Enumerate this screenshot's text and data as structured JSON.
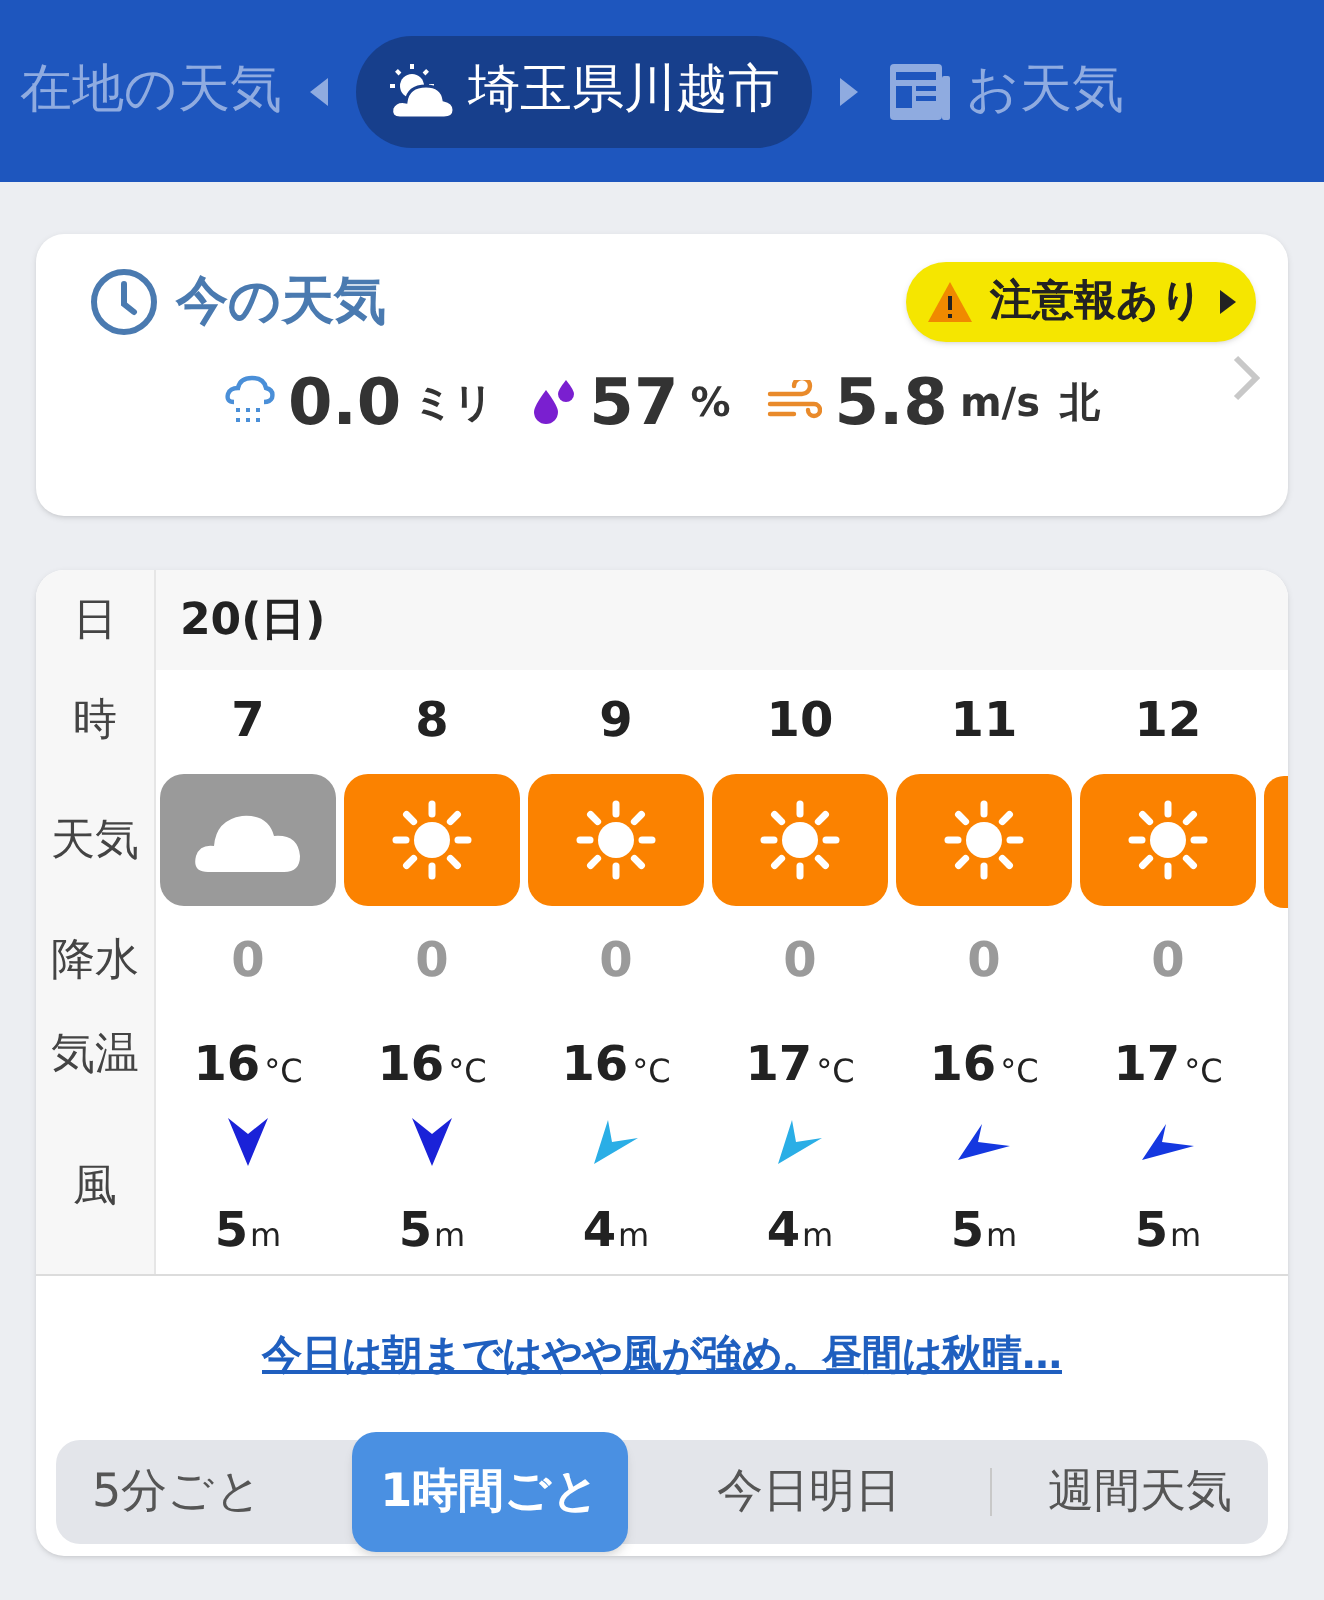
{
  "header": {
    "tabs": [
      {
        "label": "在地の天気",
        "kind": "plain",
        "selected": false
      },
      {
        "label": "埼玉県川越市",
        "kind": "location",
        "selected": true
      },
      {
        "label": "お天気",
        "kind": "news",
        "selected": false
      }
    ]
  },
  "current": {
    "title": "今の天気",
    "alert": "注意報あり",
    "stats": [
      {
        "kind": "rain",
        "value": "0.0",
        "unit": "ミリ"
      },
      {
        "kind": "humidity",
        "value": "57",
        "unit": "%"
      },
      {
        "kind": "wind",
        "value": "5.8",
        "unit": "m/s",
        "direction": "北"
      }
    ]
  },
  "forecast": {
    "row_labels": {
      "date": "日",
      "hour": "時",
      "weather": "天気",
      "precip": "降水",
      "temp": "気温",
      "wind": "風"
    },
    "date": "20(日)",
    "hours": [
      {
        "hour": "7",
        "weather": {
          "kind": "cloudy"
        },
        "precip": "0",
        "temp": "16",
        "temp_unit": "°C",
        "wind_arrow": {
          "kind": "down",
          "color": "#1a22d8"
        },
        "wind": "5",
        "wind_unit": "m"
      },
      {
        "hour": "8",
        "weather": {
          "kind": "sunny"
        },
        "precip": "0",
        "temp": "16",
        "temp_unit": "°C",
        "wind_arrow": {
          "kind": "down",
          "color": "#1a22d8"
        },
        "wind": "5",
        "wind_unit": "m"
      },
      {
        "hour": "9",
        "weather": {
          "kind": "sunny"
        },
        "precip": "0",
        "temp": "16",
        "temp_unit": "°C",
        "wind_arrow": {
          "kind": "diagonal",
          "color": "#2aaee6"
        },
        "wind": "4",
        "wind_unit": "m"
      },
      {
        "hour": "10",
        "weather": {
          "kind": "sunny"
        },
        "precip": "0",
        "temp": "17",
        "temp_unit": "°C",
        "wind_arrow": {
          "kind": "diagonal",
          "color": "#2aaee6"
        },
        "wind": "4",
        "wind_unit": "m"
      },
      {
        "hour": "11",
        "weather": {
          "kind": "sunny"
        },
        "precip": "0",
        "temp": "16",
        "temp_unit": "°C",
        "wind_arrow": {
          "kind": "flat",
          "color": "#1538e0"
        },
        "wind": "5",
        "wind_unit": "m"
      },
      {
        "hour": "12",
        "weather": {
          "kind": "sunny"
        },
        "precip": "0",
        "temp": "17",
        "temp_unit": "°C",
        "wind_arrow": {
          "kind": "flat",
          "color": "#1538e0"
        },
        "wind": "5",
        "wind_unit": "m"
      }
    ],
    "next_tile": {
      "kind": "sunny"
    },
    "summary": "今日は朝まではやや風が強め。昼間は秋晴…"
  },
  "views": [
    {
      "label": "5分ごと",
      "selected": false
    },
    {
      "label": "1時間ごと",
      "selected": true
    },
    {
      "label": "今日明日",
      "selected": false
    },
    {
      "label": "週間天気",
      "selected": false
    }
  ]
}
